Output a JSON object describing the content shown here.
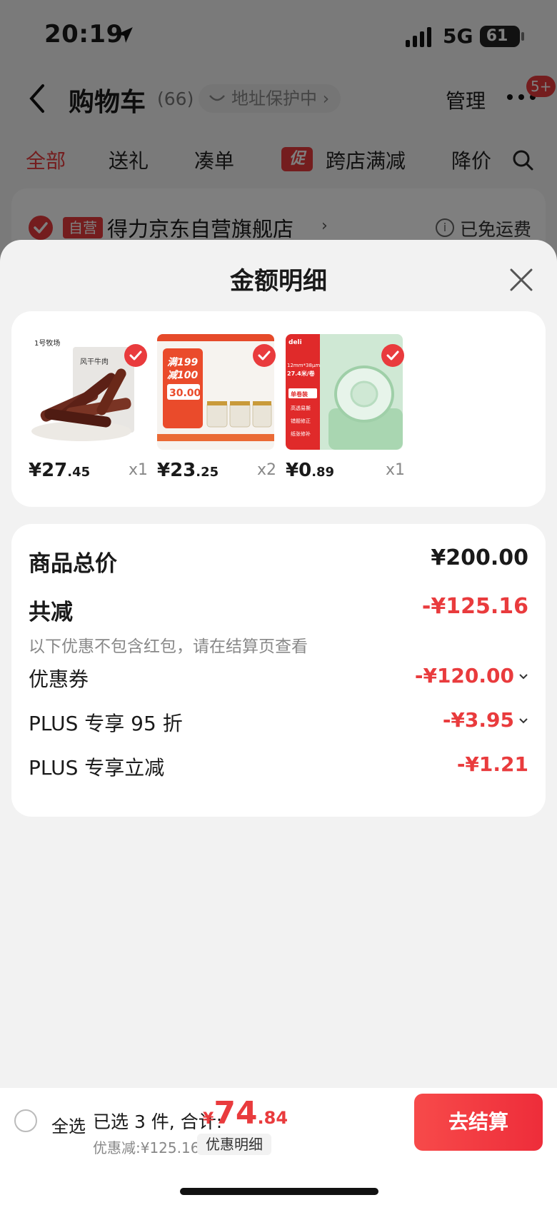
{
  "status_bar": {
    "time": "20:19",
    "network": "5G",
    "battery": "61"
  },
  "nav": {
    "title": "购物车",
    "count": "(66)",
    "address_protect": "地址保护中 ›",
    "manage": "管理",
    "badge": "5+"
  },
  "tabs": [
    {
      "label": "全部",
      "active": true
    },
    {
      "label": "送礼"
    },
    {
      "label": "凑单"
    },
    {
      "label": "跨店满减",
      "tag": "促"
    },
    {
      "label": "降价"
    }
  ],
  "store": {
    "tag": "自营",
    "name": "得力京东自营旗舰店",
    "arrow": "›",
    "shipping": "已免运费",
    "info_icon": "i"
  },
  "sheet": {
    "title": "金额明细",
    "products": [
      {
        "name": "风干牛肉",
        "price_int": "¥27",
        "price_dec": ".45",
        "qty": "x1",
        "icon": "beef-jerky-image"
      },
      {
        "name": "满199减100",
        "price_int": "¥23",
        "price_dec": ".25",
        "qty": "x2",
        "icon": "jar-set-image",
        "promo_line1": "满199",
        "promo_line2": "减100",
        "promo_price": "30.00"
      },
      {
        "name": "单卷装",
        "price_int": "¥0",
        "price_dec": ".89",
        "qty": "x1",
        "icon": "tape-image",
        "brand": "deli",
        "spec": "12mm*38μm",
        "length": "27.4米/卷",
        "pack": "单卷装",
        "f1": "高透易撕",
        "f2": "错题修正",
        "f3": "纸张修补"
      }
    ],
    "brand_logo": "1号牧场",
    "details": {
      "total_label": "商品总价",
      "total_value": "¥200.00",
      "discount_label": "共减",
      "discount_value": "-¥125.16",
      "note": "以下优惠不包含红包，请在结算页查看",
      "items": [
        {
          "label": "优惠券",
          "value": "-¥120.00",
          "chevron": true
        },
        {
          "label": "PLUS 专享 95 折",
          "value": "-¥3.95",
          "chevron": true
        },
        {
          "label": "PLUS 专享立减",
          "value": "-¥1.21",
          "chevron": false
        }
      ]
    }
  },
  "bottom": {
    "select_all": "全选",
    "selected": "已选 3 件, 合计:",
    "currency": "¥",
    "total_int": "74",
    "total_dec": ".84",
    "saved": "优惠减:¥125.16",
    "detail_link": "优惠明细",
    "checkout": "去结算"
  },
  "colors": {
    "accent": "#e93b3d"
  }
}
